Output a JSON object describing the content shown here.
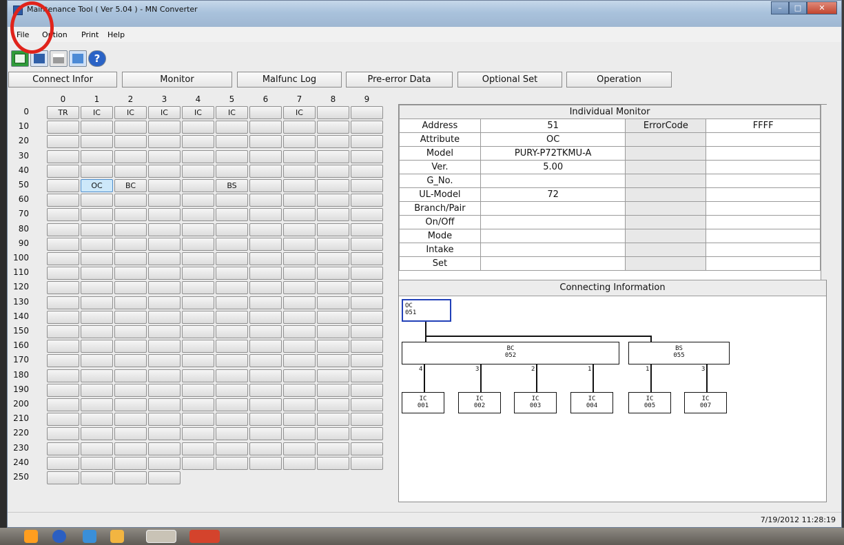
{
  "window": {
    "title": "Maintenance Tool ( Ver 5.04 ) - MN Converter"
  },
  "menu": [
    "File",
    "Option",
    "Print",
    "Help"
  ],
  "toolbar_icons": [
    "connect-icon",
    "save-icon",
    "print-icon",
    "transfer-icon",
    "help-icon"
  ],
  "tabs": [
    "Connect Infor",
    "Monitor",
    "Malfunc Log",
    "Pre-error Data",
    "Optional Set",
    "Operation"
  ],
  "grid": {
    "columns": [
      "0",
      "1",
      "2",
      "3",
      "4",
      "5",
      "6",
      "7",
      "8",
      "9"
    ],
    "rows": [
      "0",
      "10",
      "20",
      "30",
      "40",
      "50",
      "60",
      "70",
      "80",
      "90",
      "100",
      "110",
      "120",
      "130",
      "140",
      "150",
      "160",
      "170",
      "180",
      "190",
      "200",
      "210",
      "220",
      "230",
      "240",
      "250"
    ],
    "labels": {
      "0": [
        "TR",
        "IC",
        "IC",
        "IC",
        "IC",
        "IC",
        "",
        "IC",
        "",
        ""
      ],
      "50": [
        "",
        "OC",
        "BC",
        "",
        "",
        "BS",
        "",
        "",
        "",
        ""
      ]
    },
    "selected": "51"
  },
  "individual_monitor": {
    "title": "Individual Monitor",
    "rows": [
      {
        "label": "Address",
        "value": "51",
        "label2": "ErrorCode",
        "value2": "FFFF"
      },
      {
        "label": "Attribute",
        "value": "OC",
        "label2": "",
        "value2": ""
      },
      {
        "label": "Model",
        "value": "PURY-P72TKMU-A",
        "label2": "",
        "value2": ""
      },
      {
        "label": "Ver.",
        "value": "5.00",
        "label2": "",
        "value2": ""
      },
      {
        "label": "G_No.",
        "value": "",
        "label2": "",
        "value2": ""
      },
      {
        "label": "UL-Model",
        "value": "72",
        "label2": "",
        "value2": ""
      },
      {
        "label": "Branch/Pair",
        "value": "",
        "label2": "",
        "value2": ""
      },
      {
        "label": "On/Off",
        "value": "",
        "label2": "",
        "value2": ""
      },
      {
        "label": "Mode",
        "value": "",
        "label2": "",
        "value2": ""
      },
      {
        "label": "Intake",
        "value": "",
        "label2": "",
        "value2": ""
      },
      {
        "label": "Set",
        "value": "",
        "label2": "",
        "value2": ""
      }
    ]
  },
  "connecting_info": {
    "title": "Connecting Information",
    "oc": {
      "type": "OC",
      "addr": "051"
    },
    "bc": {
      "type": "BC",
      "addr": "052"
    },
    "bs": {
      "type": "BS",
      "addr": "055"
    },
    "ics": [
      {
        "type": "IC",
        "addr": "001",
        "port": "4"
      },
      {
        "type": "IC",
        "addr": "002",
        "port": "3"
      },
      {
        "type": "IC",
        "addr": "003",
        "port": "2"
      },
      {
        "type": "IC",
        "addr": "004",
        "port": "1"
      },
      {
        "type": "IC",
        "addr": "005",
        "port": "1"
      },
      {
        "type": "IC",
        "addr": "007",
        "port": "3"
      }
    ]
  },
  "status": {
    "datetime": "7/19/2012 11:28:19"
  }
}
